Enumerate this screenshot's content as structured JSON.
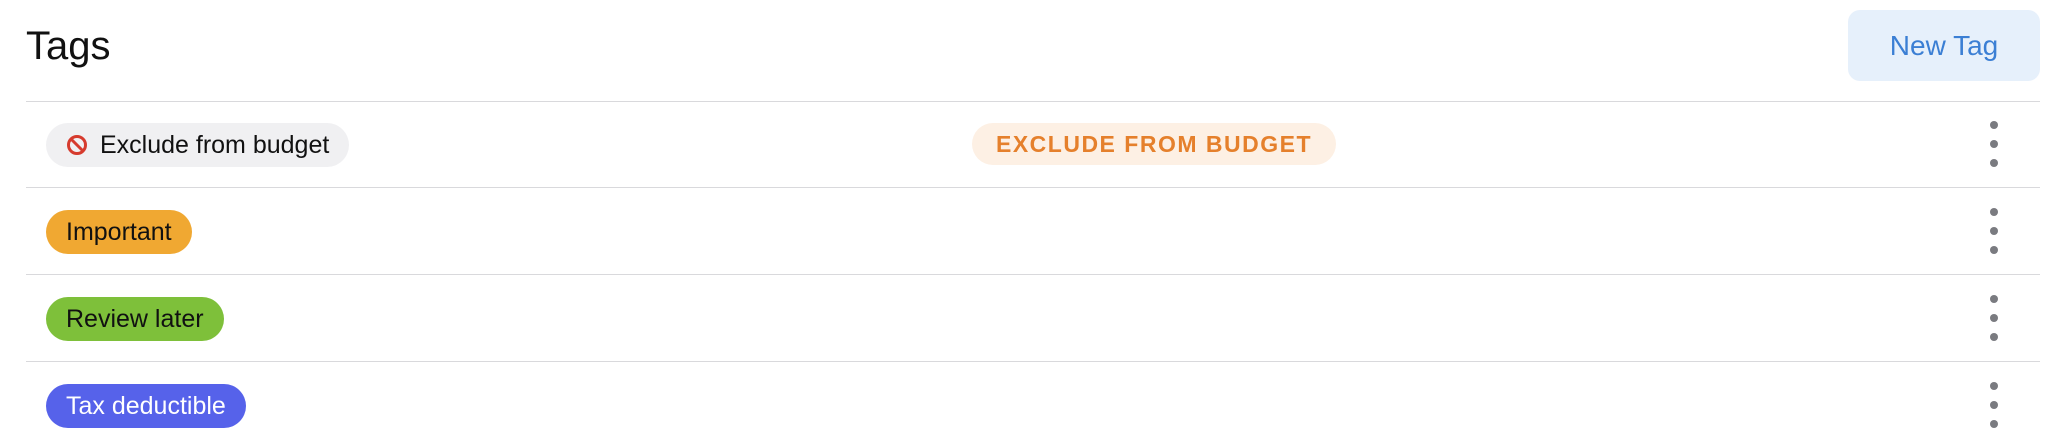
{
  "header": {
    "title": "Tags",
    "new_tag_label": "New Tag"
  },
  "colors": {
    "accent": "#3b7fd4",
    "button_bg": "#e6f0fb",
    "divider": "#d9d9dc",
    "menu_dots": "#7a7b80"
  },
  "tags": [
    {
      "label": "Exclude from budget",
      "icon": "prohibited-icon",
      "pill_bg": "#f0f0f2",
      "pill_text": "#111111",
      "badge": "EXCLUDE FROM BUDGET",
      "badge_bg": "#fdf0e4",
      "badge_text": "#e5802c"
    },
    {
      "label": "Important",
      "pill_bg": "#f0a832",
      "pill_text": "#111111"
    },
    {
      "label": "Review later",
      "pill_bg": "#7ec03a",
      "pill_text": "#111111"
    },
    {
      "label": "Tax deductible",
      "pill_bg": "#5662ea",
      "pill_text": "#ffffff"
    }
  ]
}
